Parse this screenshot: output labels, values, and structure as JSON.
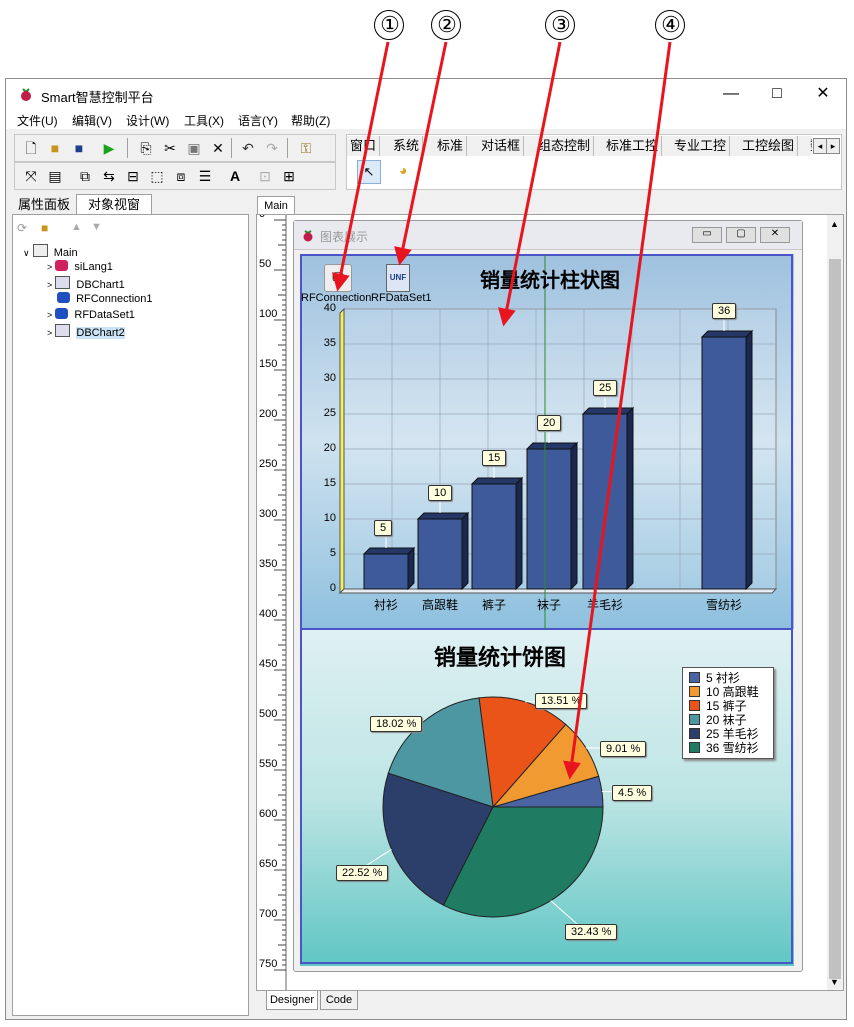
{
  "callouts": [
    "①",
    "②",
    "③",
    "④"
  ],
  "app": {
    "title": "Smart智慧控制平台",
    "logo": "raspberry-icon"
  },
  "window_controls": {
    "minimize": "—",
    "maximize": "□",
    "close": "✕"
  },
  "menu": [
    "文件(U)",
    "编辑(V)",
    "设计(W)",
    "工具(X)",
    "语言(Y)",
    "帮助(Z)"
  ],
  "component_tabs": [
    "窗口",
    "系统",
    "标准",
    "对话框",
    "组态控制",
    "标准工控",
    "专业工控",
    "工控绘图",
    "数"
  ],
  "left_tabs": [
    "属性面板",
    "对象视窗"
  ],
  "tree": {
    "root": "Main",
    "items": [
      "siLang1",
      "DBChart1",
      "RFConnection1",
      "RFDataSet1",
      "DBChart2"
    ]
  },
  "doc_tab": "Main",
  "bottom_tabs": [
    "Designer",
    "Code"
  ],
  "ruler": [
    "0",
    "50",
    "100",
    "150",
    "200",
    "250",
    "300",
    "350",
    "400",
    "450",
    "500",
    "550",
    "600",
    "650",
    "700",
    "750"
  ],
  "form": {
    "title": "图表展示",
    "component_labels": [
      "RFConnection",
      "RFDataSet1"
    ],
    "unf_text": "UNF"
  },
  "colors": {
    "bar": "#3f5a9a",
    "pie": [
      "#4a63a3",
      "#f29a32",
      "#ea5419",
      "#4d97a3",
      "#2c3e6a",
      "#1f7b62"
    ],
    "arrow": "#e8141e"
  },
  "chart_data": [
    {
      "type": "bar",
      "title": "销量统计柱状图",
      "categories": [
        "衬衫",
        "高跟鞋",
        "裤子",
        "袜子",
        "羊毛衫",
        "雪纺衫"
      ],
      "values": [
        5,
        10,
        15,
        20,
        25,
        36
      ],
      "value_labels": [
        "5",
        "10",
        "15",
        "20",
        "25",
        "36"
      ],
      "yticks": [
        "0",
        "5",
        "10",
        "15",
        "20",
        "25",
        "30",
        "35",
        "40"
      ],
      "ylim": [
        0,
        40
      ],
      "grid": true,
      "style": "3d"
    },
    {
      "type": "pie",
      "title": "销量统计饼图",
      "categories": [
        "衬衫",
        "高跟鞋",
        "裤子",
        "袜子",
        "羊毛衫",
        "雪纺衫"
      ],
      "values": [
        5,
        10,
        15,
        20,
        25,
        36
      ],
      "percent_labels": [
        "4.5 %",
        "9.01 %",
        "13.51 %",
        "18.02 %",
        "22.52 %",
        "32.43 %"
      ],
      "legend": [
        "5 衬衫",
        "10 高跟鞋",
        "15 裤子",
        "20 袜子",
        "25 羊毛衫",
        "36 雪纺衫"
      ],
      "legend_position": "top-right"
    }
  ]
}
